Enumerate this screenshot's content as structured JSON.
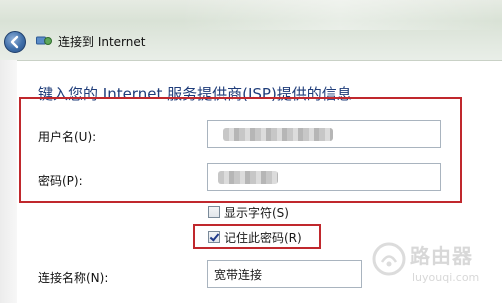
{
  "window": {
    "title": "连接到 Internet"
  },
  "main": {
    "heading": "键入您的 Internet 服务提供商(ISP)提供的信息",
    "username": {
      "label": "用户名(U):",
      "value": ""
    },
    "password": {
      "label": "密码(P):",
      "value": ""
    },
    "show_chars": {
      "label": "显示字符(S)",
      "checked": false
    },
    "remember_password": {
      "label": "记住此密码(R)",
      "checked": true
    },
    "connection_name": {
      "label": "连接名称(N):",
      "value": "宽带连接"
    }
  },
  "watermark": {
    "text_top": "路由器",
    "text_bottom": "luyouqi.com"
  },
  "colors": {
    "heading": "#1f3d7a",
    "highlight_frame": "#c0282d",
    "titlebar": "#dde5da"
  }
}
